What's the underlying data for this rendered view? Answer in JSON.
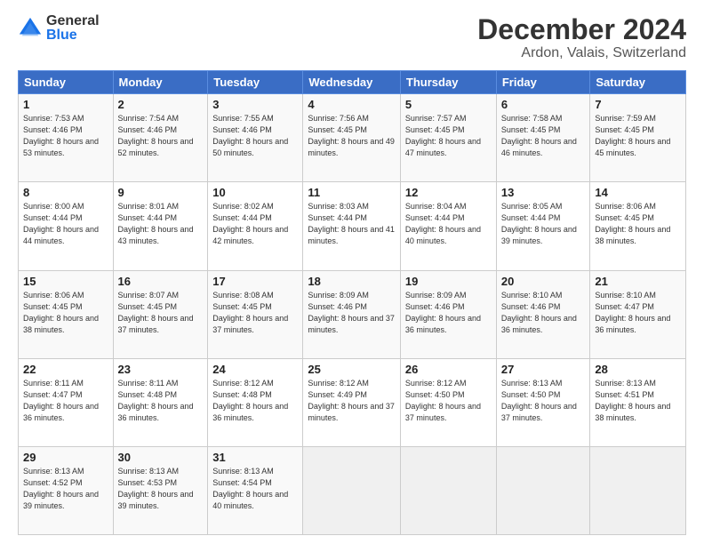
{
  "logo": {
    "general": "General",
    "blue": "Blue"
  },
  "header": {
    "month": "December 2024",
    "location": "Ardon, Valais, Switzerland"
  },
  "weekdays": [
    "Sunday",
    "Monday",
    "Tuesday",
    "Wednesday",
    "Thursday",
    "Friday",
    "Saturday"
  ],
  "weeks": [
    [
      {
        "day": "1",
        "sunrise": "7:53 AM",
        "sunset": "4:46 PM",
        "daylight": "8 hours and 53 minutes."
      },
      {
        "day": "2",
        "sunrise": "7:54 AM",
        "sunset": "4:46 PM",
        "daylight": "8 hours and 52 minutes."
      },
      {
        "day": "3",
        "sunrise": "7:55 AM",
        "sunset": "4:46 PM",
        "daylight": "8 hours and 50 minutes."
      },
      {
        "day": "4",
        "sunrise": "7:56 AM",
        "sunset": "4:45 PM",
        "daylight": "8 hours and 49 minutes."
      },
      {
        "day": "5",
        "sunrise": "7:57 AM",
        "sunset": "4:45 PM",
        "daylight": "8 hours and 47 minutes."
      },
      {
        "day": "6",
        "sunrise": "7:58 AM",
        "sunset": "4:45 PM",
        "daylight": "8 hours and 46 minutes."
      },
      {
        "day": "7",
        "sunrise": "7:59 AM",
        "sunset": "4:45 PM",
        "daylight": "8 hours and 45 minutes."
      }
    ],
    [
      {
        "day": "8",
        "sunrise": "8:00 AM",
        "sunset": "4:44 PM",
        "daylight": "8 hours and 44 minutes."
      },
      {
        "day": "9",
        "sunrise": "8:01 AM",
        "sunset": "4:44 PM",
        "daylight": "8 hours and 43 minutes."
      },
      {
        "day": "10",
        "sunrise": "8:02 AM",
        "sunset": "4:44 PM",
        "daylight": "8 hours and 42 minutes."
      },
      {
        "day": "11",
        "sunrise": "8:03 AM",
        "sunset": "4:44 PM",
        "daylight": "8 hours and 41 minutes."
      },
      {
        "day": "12",
        "sunrise": "8:04 AM",
        "sunset": "4:44 PM",
        "daylight": "8 hours and 40 minutes."
      },
      {
        "day": "13",
        "sunrise": "8:05 AM",
        "sunset": "4:44 PM",
        "daylight": "8 hours and 39 minutes."
      },
      {
        "day": "14",
        "sunrise": "8:06 AM",
        "sunset": "4:45 PM",
        "daylight": "8 hours and 38 minutes."
      }
    ],
    [
      {
        "day": "15",
        "sunrise": "8:06 AM",
        "sunset": "4:45 PM",
        "daylight": "8 hours and 38 minutes."
      },
      {
        "day": "16",
        "sunrise": "8:07 AM",
        "sunset": "4:45 PM",
        "daylight": "8 hours and 37 minutes."
      },
      {
        "day": "17",
        "sunrise": "8:08 AM",
        "sunset": "4:45 PM",
        "daylight": "8 hours and 37 minutes."
      },
      {
        "day": "18",
        "sunrise": "8:09 AM",
        "sunset": "4:46 PM",
        "daylight": "8 hours and 37 minutes."
      },
      {
        "day": "19",
        "sunrise": "8:09 AM",
        "sunset": "4:46 PM",
        "daylight": "8 hours and 36 minutes."
      },
      {
        "day": "20",
        "sunrise": "8:10 AM",
        "sunset": "4:46 PM",
        "daylight": "8 hours and 36 minutes."
      },
      {
        "day": "21",
        "sunrise": "8:10 AM",
        "sunset": "4:47 PM",
        "daylight": "8 hours and 36 minutes."
      }
    ],
    [
      {
        "day": "22",
        "sunrise": "8:11 AM",
        "sunset": "4:47 PM",
        "daylight": "8 hours and 36 minutes."
      },
      {
        "day": "23",
        "sunrise": "8:11 AM",
        "sunset": "4:48 PM",
        "daylight": "8 hours and 36 minutes."
      },
      {
        "day": "24",
        "sunrise": "8:12 AM",
        "sunset": "4:48 PM",
        "daylight": "8 hours and 36 minutes."
      },
      {
        "day": "25",
        "sunrise": "8:12 AM",
        "sunset": "4:49 PM",
        "daylight": "8 hours and 37 minutes."
      },
      {
        "day": "26",
        "sunrise": "8:12 AM",
        "sunset": "4:50 PM",
        "daylight": "8 hours and 37 minutes."
      },
      {
        "day": "27",
        "sunrise": "8:13 AM",
        "sunset": "4:50 PM",
        "daylight": "8 hours and 37 minutes."
      },
      {
        "day": "28",
        "sunrise": "8:13 AM",
        "sunset": "4:51 PM",
        "daylight": "8 hours and 38 minutes."
      }
    ],
    [
      {
        "day": "29",
        "sunrise": "8:13 AM",
        "sunset": "4:52 PM",
        "daylight": "8 hours and 39 minutes."
      },
      {
        "day": "30",
        "sunrise": "8:13 AM",
        "sunset": "4:53 PM",
        "daylight": "8 hours and 39 minutes."
      },
      {
        "day": "31",
        "sunrise": "8:13 AM",
        "sunset": "4:54 PM",
        "daylight": "8 hours and 40 minutes."
      },
      null,
      null,
      null,
      null
    ]
  ]
}
